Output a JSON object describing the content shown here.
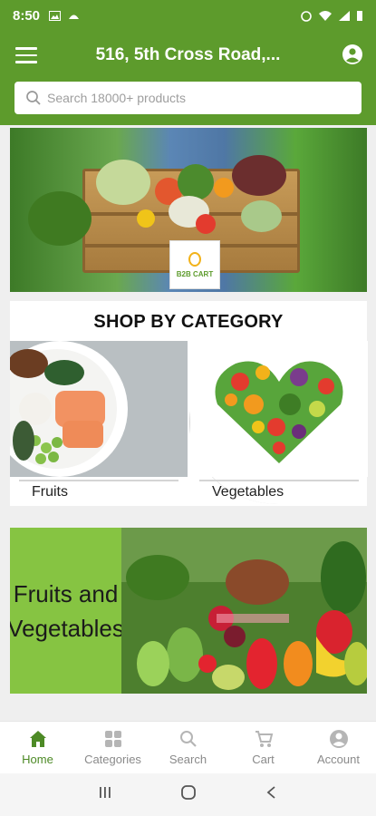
{
  "status_bar": {
    "time": "8:50"
  },
  "app_bar": {
    "address": "516, 5th Cross Road,...",
    "search_placeholder": "Search 18000+ products",
    "brand_color": "#5d9b2c"
  },
  "hero": {
    "badge_text": "B2B CART"
  },
  "categories": {
    "title": "SHOP BY CATEGORY",
    "items": [
      {
        "label": "Fruits"
      },
      {
        "label": "Vegetables"
      }
    ]
  },
  "promo": {
    "line1": "Fruits and",
    "line2": "Vegetables"
  },
  "bottom_nav": [
    {
      "label": "Home",
      "icon": "home-icon",
      "active": true
    },
    {
      "label": "Categories",
      "icon": "grid-icon",
      "active": false
    },
    {
      "label": "Search",
      "icon": "search-icon",
      "active": false
    },
    {
      "label": "Cart",
      "icon": "cart-icon",
      "active": false
    },
    {
      "label": "Account",
      "icon": "account-icon",
      "active": false
    }
  ]
}
